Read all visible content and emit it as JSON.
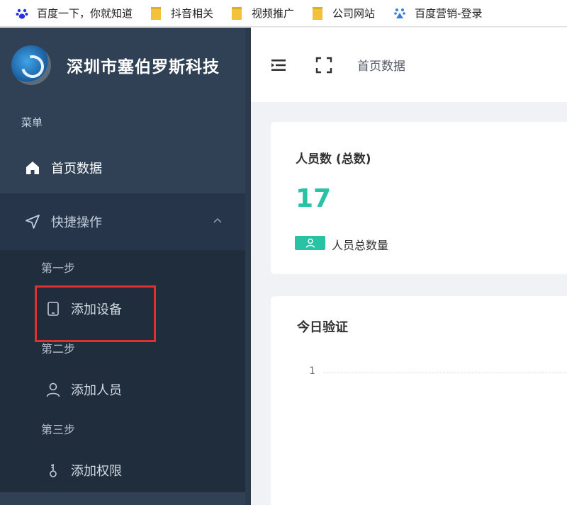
{
  "bookmarks": [
    {
      "label": "百度一下，你就知道",
      "icon": "baidu-paw-icon"
    },
    {
      "label": "抖音相关",
      "icon": "folder-icon"
    },
    {
      "label": "视频推广",
      "icon": "folder-icon"
    },
    {
      "label": "公司网站",
      "icon": "folder-icon"
    },
    {
      "label": "百度营销-登录",
      "icon": "baidu-marketing-icon"
    }
  ],
  "brand": {
    "title": "深圳市塞伯罗斯科技"
  },
  "sidebar": {
    "caption": "菜单",
    "home": {
      "label": "首页数据",
      "icon": "home-icon"
    },
    "quick": {
      "label": "快捷操作",
      "icon": "navigation-arrow-icon"
    },
    "steps": [
      {
        "label": "第一步"
      },
      {
        "label": "第二步"
      },
      {
        "label": "第三步"
      }
    ],
    "items": [
      {
        "label": "添加设备",
        "icon": "tablet-icon"
      },
      {
        "label": "添加人员",
        "icon": "user-icon"
      },
      {
        "label": "添加权限",
        "icon": "key-icon"
      }
    ]
  },
  "header": {
    "breadcrumb": "首页数据",
    "menu_icon": "menu-toggle-icon",
    "fullscreen_icon": "fullscreen-icon"
  },
  "stats_card": {
    "title": "人员数 (总数)",
    "value": "17",
    "badge_label": "人员总数量"
  },
  "verify_card": {
    "title": "今日验证",
    "y_tick": "1"
  },
  "colors": {
    "sidebar": "#304156",
    "accent": "#28c2a5",
    "highlight": "#e02f2f"
  }
}
